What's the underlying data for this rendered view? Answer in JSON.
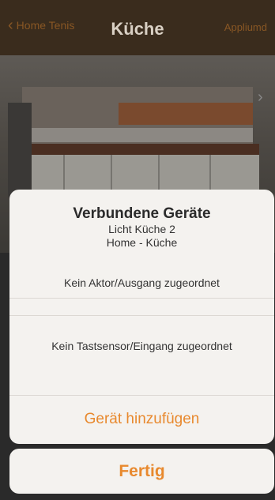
{
  "app": {
    "nav": {
      "back_label": "Home Tenis",
      "title": "Küche",
      "right_label": "Appliumd"
    }
  },
  "sheet": {
    "title": "Verbundene Geräte",
    "device_name": "Licht Küche 2",
    "location": "Home - Küche",
    "actor_status": "Kein Aktor/Ausgang zugeordnet",
    "sensor_status": "Kein Tastsensor/Eingang zugeordnet",
    "add_button": "Gerät hinzufügen"
  },
  "done_button": "Fertig",
  "colors": {
    "accent": "#e8892e",
    "sheet_bg": "#f4f2ef"
  },
  "icons": [
    "chevron-left-icon"
  ]
}
